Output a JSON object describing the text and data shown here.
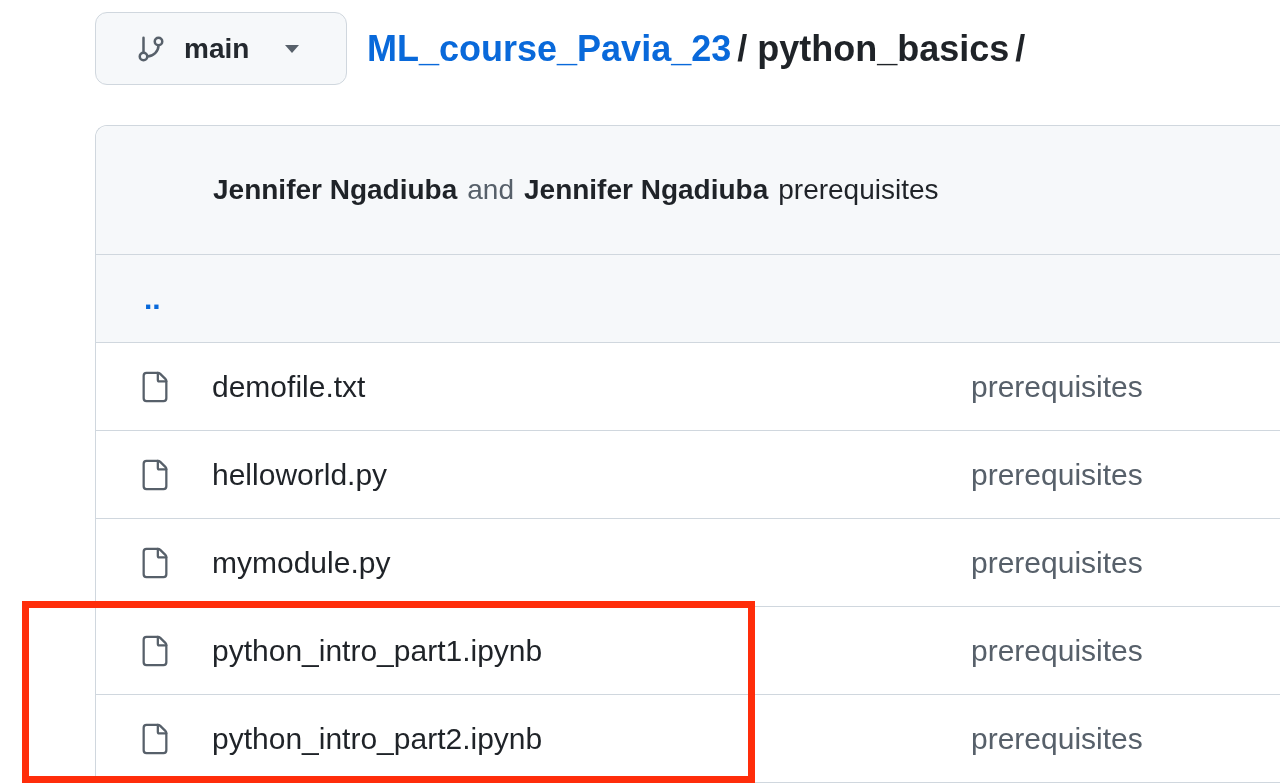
{
  "branch": {
    "name": "main"
  },
  "breadcrumb": [
    {
      "kind": "link",
      "text": "ML_course_Pavia_23"
    },
    {
      "kind": "separator",
      "text": "/"
    },
    {
      "kind": "current",
      "text": "python_basics"
    },
    {
      "kind": "separator",
      "text": "/"
    }
  ],
  "commit": {
    "author": "Jennifer Ngadiuba",
    "conjunction": "and",
    "coauthor": "Jennifer Ngadiuba",
    "message": "prerequisites"
  },
  "parent_link": "..",
  "files": [
    {
      "name": "demofile.txt",
      "message": "prerequisites",
      "highlighted": false
    },
    {
      "name": "helloworld.py",
      "message": "prerequisites",
      "highlighted": false
    },
    {
      "name": "mymodule.py",
      "message": "prerequisites",
      "highlighted": false
    },
    {
      "name": "python_intro_part1.ipynb",
      "message": "prerequisites",
      "highlighted": true
    },
    {
      "name": "python_intro_part2.ipynb",
      "message": "prerequisites",
      "highlighted": true
    }
  ]
}
